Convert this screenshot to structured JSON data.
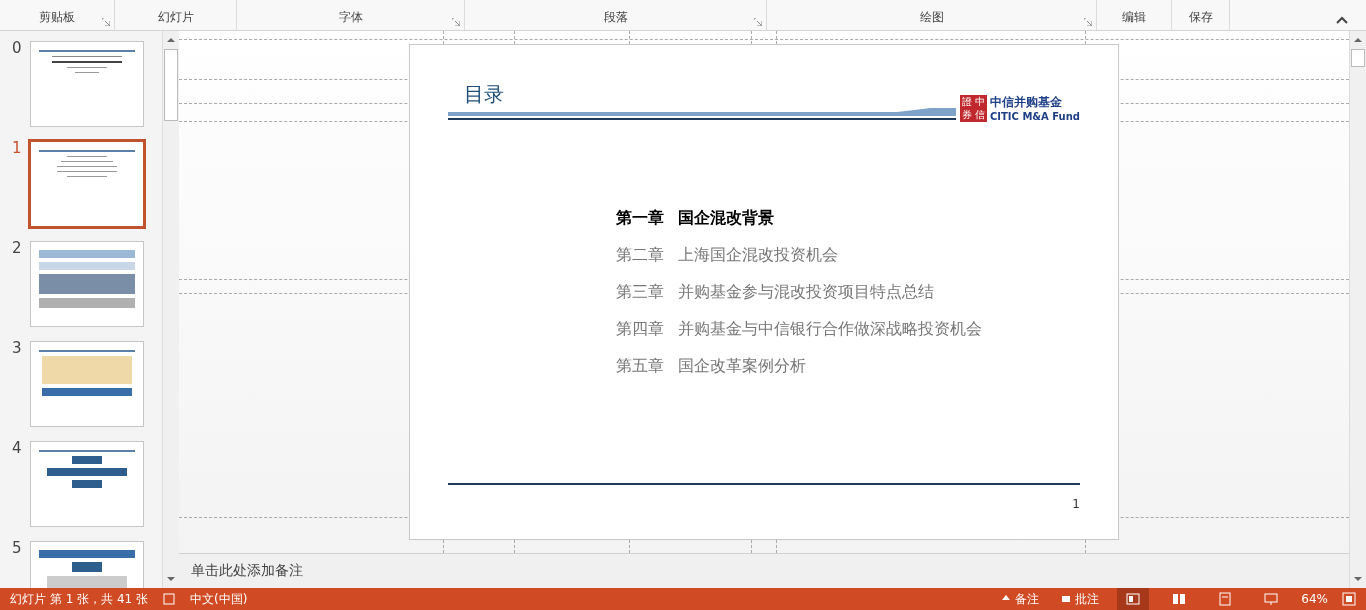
{
  "ribbon": {
    "groups": [
      {
        "label": "剪贴板",
        "launcher": true
      },
      {
        "label": "幻灯片",
        "launcher": false
      },
      {
        "label": "字体",
        "launcher": true
      },
      {
        "label": "段落",
        "launcher": true
      },
      {
        "label": "绘图",
        "launcher": true
      },
      {
        "label": "编辑",
        "launcher": false
      },
      {
        "label": "保存",
        "launcher": false
      }
    ]
  },
  "thumbnails": [
    {
      "number": "0",
      "selected": false,
      "kind": "cover"
    },
    {
      "number": "1",
      "selected": true,
      "kind": "list"
    },
    {
      "number": "2",
      "selected": false,
      "kind": "table"
    },
    {
      "number": "3",
      "selected": false,
      "kind": "diagram"
    },
    {
      "number": "4",
      "selected": false,
      "kind": "cycle"
    },
    {
      "number": "5",
      "selected": false,
      "kind": "tree"
    }
  ],
  "slide": {
    "title": "目录",
    "logo": {
      "seal": [
        "證",
        "中",
        "券",
        "信"
      ],
      "name": "中信并购基金",
      "english": "CITIC M&A Fund"
    },
    "chapters": [
      {
        "number": "第一章",
        "title": "国企混改背景",
        "emphasized": true
      },
      {
        "number": "第二章",
        "title": "上海国企混改投资机会",
        "emphasized": false
      },
      {
        "number": "第三章",
        "title": "并购基金参与混改投资项目特点总结",
        "emphasized": false
      },
      {
        "number": "第四章",
        "title": "并购基金与中信银行合作做深战略投资机会",
        "emphasized": false
      },
      {
        "number": "第五章",
        "title": "国企改革案例分析",
        "emphasized": false
      }
    ],
    "page_number": "1"
  },
  "notes": {
    "placeholder": "单击此处添加备注"
  },
  "status_bar": {
    "slide_info": "幻灯片 第 1 张，共 41 张",
    "language": "中文(中国)",
    "notes_button": "备注",
    "comments_button": "批注",
    "views": [
      {
        "kind": "normal",
        "selected": true
      },
      {
        "kind": "sorter",
        "selected": false
      },
      {
        "kind": "reading",
        "selected": false
      },
      {
        "kind": "show",
        "selected": false
      }
    ],
    "zoom": "64%"
  }
}
